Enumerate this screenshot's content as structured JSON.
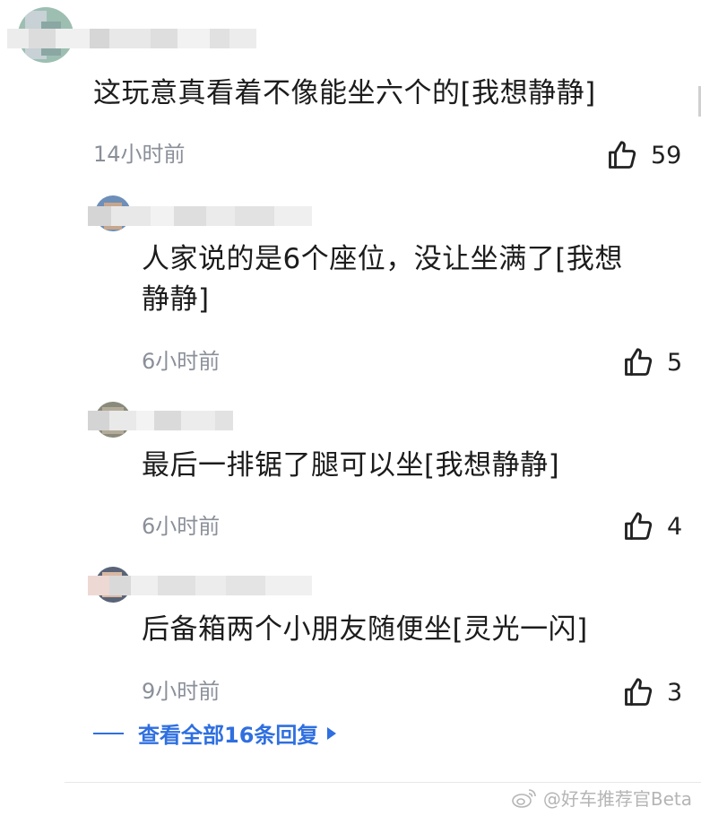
{
  "comments": [
    {
      "text": "这玩意真看着不像能坐六个的[我想静静]",
      "time": "14小时前",
      "likes": "59"
    },
    {
      "text_line1": "人家说的是6个座位，没让坐满了[我想",
      "text_line2": "静静]",
      "time": "6小时前",
      "likes": "5"
    },
    {
      "text": "最后一排锯了腿可以坐[我想静静]",
      "time": "6小时前",
      "likes": "4"
    },
    {
      "text": "后备箱两个小朋友随便坐[灵光一闪]",
      "time": "9小时前",
      "likes": "3"
    }
  ],
  "expand_replies": {
    "label": "查看全部16条回复"
  },
  "watermark": {
    "text": "@好车推荐官Beta"
  },
  "icons": {
    "like": "thumbs-up-icon",
    "expand": "triangle-right-icon",
    "weibo": "weibo-logo-icon"
  },
  "colors": {
    "link": "#2f6fe0",
    "meta": "#8a8f99",
    "text": "#1c1c1c"
  }
}
